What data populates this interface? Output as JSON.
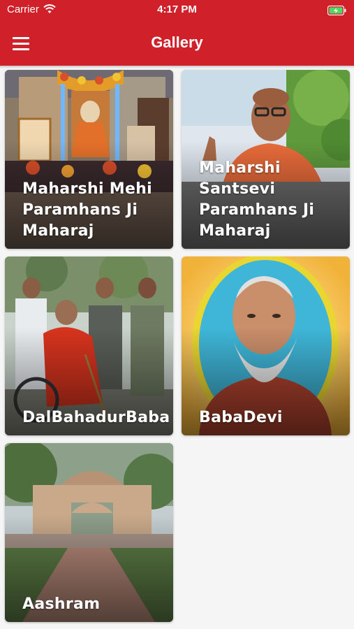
{
  "status_bar": {
    "carrier": "Carrier",
    "time": "4:17 PM"
  },
  "header": {
    "title": "Gallery",
    "menu_icon": "hamburger-menu-icon"
  },
  "gallery": {
    "items": [
      {
        "label": "Maharshi Mehi Paramhans Ji Maharaj"
      },
      {
        "label": "Maharshi Santsevi Paramhans  Ji Maharaj"
      },
      {
        "label": "DalBahadurBaba"
      },
      {
        "label": "BabaDevi"
      },
      {
        "label": "Aashram"
      }
    ]
  },
  "colors": {
    "header": "#d0212a",
    "background": "#f5f5f6"
  }
}
